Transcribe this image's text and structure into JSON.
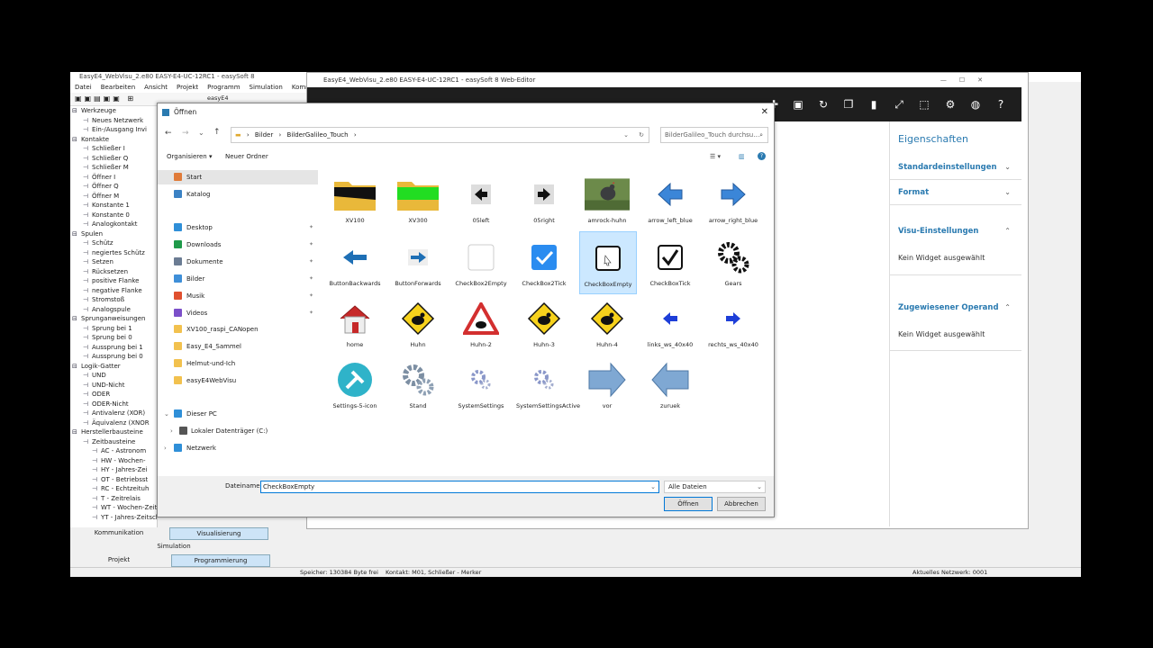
{
  "back_window": {
    "title": "EasyE4_WebVisu_2.e80 EASY-E4-UC-12RC1 - easySoft 8",
    "menu": [
      "Datei",
      "Bearbeiten",
      "Ansicht",
      "Projekt",
      "Programm",
      "Simulation",
      "Kommunikation"
    ],
    "toolbar_combo": "easyE4"
  },
  "tree": [
    {
      "label": "Werkzeuge",
      "level": 0
    },
    {
      "label": "Neues Netzwerk",
      "level": 1
    },
    {
      "label": "Ein-/Ausgang Invi",
      "level": 1
    },
    {
      "label": "Kontakte",
      "level": 0
    },
    {
      "label": "Schließer I",
      "level": 1
    },
    {
      "label": "Schließer Q",
      "level": 1
    },
    {
      "label": "Schließer M",
      "level": 1
    },
    {
      "label": "Öffner I",
      "level": 1
    },
    {
      "label": "Öffner Q",
      "level": 1
    },
    {
      "label": "Öffner M",
      "level": 1
    },
    {
      "label": "Konstante 1",
      "level": 1
    },
    {
      "label": "Konstante 0",
      "level": 1
    },
    {
      "label": "Analogkontakt",
      "level": 1
    },
    {
      "label": "Spulen",
      "level": 0
    },
    {
      "label": "Schütz",
      "level": 1
    },
    {
      "label": "negiertes Schütz",
      "level": 1
    },
    {
      "label": "Setzen",
      "level": 1
    },
    {
      "label": "Rücksetzen",
      "level": 1
    },
    {
      "label": "positive Flanke",
      "level": 1
    },
    {
      "label": "negative Flanke",
      "level": 1
    },
    {
      "label": "Stromstoß",
      "level": 1
    },
    {
      "label": "Analogspule",
      "level": 1
    },
    {
      "label": "Sprunganweisungen",
      "level": 0
    },
    {
      "label": "Sprung bei 1",
      "level": 1
    },
    {
      "label": "Sprung bei 0",
      "level": 1
    },
    {
      "label": "Aussprung bei 1",
      "level": 1
    },
    {
      "label": "Aussprung bei 0",
      "level": 1
    },
    {
      "label": "Logik-Gatter",
      "level": 0
    },
    {
      "label": "UND",
      "level": 1
    },
    {
      "label": "UND-Nicht",
      "level": 1
    },
    {
      "label": "ODER",
      "level": 1
    },
    {
      "label": "ODER-Nicht",
      "level": 1
    },
    {
      "label": "Antivalenz (XOR)",
      "level": 1
    },
    {
      "label": "Äquivalenz (XNOR",
      "level": 1
    },
    {
      "label": "Herstellerbausteine",
      "level": 0
    },
    {
      "label": "Zeitbausteine",
      "level": 1
    },
    {
      "label": "AC - Astronom",
      "level": 2
    },
    {
      "label": "HW - Wochen-",
      "level": 2
    },
    {
      "label": "HY - Jahres-Zei",
      "level": 2
    },
    {
      "label": "OT - Betriebsst",
      "level": 2
    },
    {
      "label": "RC - Echtzeituh",
      "level": 2
    },
    {
      "label": "T - Zeitrelais",
      "level": 2
    },
    {
      "label": "WT - Wochen-Zeitschaltuhr (neu)",
      "level": 2
    },
    {
      "label": "YT - Jahres-Zeitschaltuhr (neu)",
      "level": 2
    }
  ],
  "bottom_left": {
    "kommunikation": "Kommunikation",
    "visualisierung": "Visualisierung",
    "simulation": "Simulation",
    "projekt": "Projekt",
    "programmierung": "Programmierung"
  },
  "statusbar": {
    "memory": "Speicher: 130384 Byte frei",
    "contact": "Kontakt: M01, Schließer - Merker",
    "network": "Aktuelles Netzwerk: 0001"
  },
  "editor": {
    "title": "EasyE4_WebVisu_2.e80 EASY-E4-UC-12RC1 - easySoft 8 Web-Editor",
    "props": {
      "heading": "Eigenschaften",
      "standard": "Standardeinstellungen",
      "format": "Format",
      "visu": "Visu-Einstellungen",
      "visu_text": "Kein Widget ausgewählt",
      "operand": "Zugewiesener Operand",
      "operand_text": "Kein Widget ausgewählt"
    }
  },
  "dialog": {
    "title": "Öffnen",
    "breadcrumb": [
      "Bilder",
      "BilderGalileo_Touch"
    ],
    "search_placeholder": "BilderGalileo_Touch durchsu...",
    "organize": "Organisieren ▾",
    "new_folder": "Neuer Ordner",
    "nav": [
      {
        "label": "Start",
        "icon": "home-icon",
        "color": "#e07b39",
        "selected": true
      },
      {
        "label": "Katalog",
        "icon": "gallery-icon",
        "color": "#3b82c4"
      },
      {
        "label": "Desktop",
        "icon": "desktop-icon",
        "color": "#2f8fd8",
        "pinned": true
      },
      {
        "label": "Downloads",
        "icon": "downloads-icon",
        "color": "#1f9a4a",
        "pinned": true
      },
      {
        "label": "Dokumente",
        "icon": "documents-icon",
        "color": "#6b7c93",
        "pinned": true
      },
      {
        "label": "Bilder",
        "icon": "pictures-icon",
        "color": "#3f8fd8",
        "pinned": true
      },
      {
        "label": "Musik",
        "icon": "music-icon",
        "color": "#e0502f",
        "pinned": true
      },
      {
        "label": "Videos",
        "icon": "videos-icon",
        "color": "#7b4fc9",
        "pinned": true
      },
      {
        "label": "XV100_raspi_CANopen",
        "icon": "folder-icon",
        "color": "#f2c14e"
      },
      {
        "label": "Easy_E4_Sammel",
        "icon": "folder-icon",
        "color": "#f2c14e"
      },
      {
        "label": "Helmut-und-Ich",
        "icon": "folder-icon",
        "color": "#f2c14e"
      },
      {
        "label": "easyE4WebVisu",
        "icon": "folder-icon",
        "color": "#f2c14e"
      },
      {
        "label": "Dieser PC",
        "icon": "pc-icon",
        "color": "#2f8fd8",
        "expanded": true
      },
      {
        "label": "Lokaler Datenträger (C:)",
        "icon": "drive-icon",
        "color": "#555"
      },
      {
        "label": "Netzwerk",
        "icon": "network-icon",
        "color": "#2f8fd8"
      }
    ],
    "files": [
      {
        "name": "XV100",
        "kind": "folder-black"
      },
      {
        "name": "XV300",
        "kind": "folder-green"
      },
      {
        "name": "05left",
        "kind": "arrow-left-black"
      },
      {
        "name": "05right",
        "kind": "arrow-right-black"
      },
      {
        "name": "amrock-huhn",
        "kind": "photo"
      },
      {
        "name": "arrow_left_blue",
        "kind": "arrow-left-blue"
      },
      {
        "name": "arrow_right_blue",
        "kind": "arrow-right-blue"
      },
      {
        "name": "ButtonBackwards",
        "kind": "btn-back"
      },
      {
        "name": "ButtonForwards",
        "kind": "btn-fwd"
      },
      {
        "name": "CheckBox2Empty",
        "kind": "cb-empty-grey"
      },
      {
        "name": "CheckBox2Tick",
        "kind": "cb-blue-tick"
      },
      {
        "name": "CheckBoxEmpty",
        "kind": "cb-empty",
        "selected": true
      },
      {
        "name": "CheckBoxTick",
        "kind": "cb-tick"
      },
      {
        "name": "Gears",
        "kind": "gears"
      },
      {
        "name": "home",
        "kind": "home"
      },
      {
        "name": "Huhn",
        "kind": "sign-yellow"
      },
      {
        "name": "Huhn-2",
        "kind": "sign-red"
      },
      {
        "name": "Huhn-3",
        "kind": "sign-yellow"
      },
      {
        "name": "Huhn-4",
        "kind": "sign-yellow"
      },
      {
        "name": "links_ws_40x40",
        "kind": "small-left"
      },
      {
        "name": "rechts_ws_40x40",
        "kind": "small-right"
      },
      {
        "name": "Settings-5-icon",
        "kind": "settings-round"
      },
      {
        "name": "Stand",
        "kind": "gears-grey"
      },
      {
        "name": "SystemSettings",
        "kind": "gears-small"
      },
      {
        "name": "SystemSettingsActive",
        "kind": "gears-small"
      },
      {
        "name": "vor",
        "kind": "big-arrow-right"
      },
      {
        "name": "zuruek",
        "kind": "big-arrow-left"
      }
    ],
    "filename_label": "Dateiname:",
    "filename_value": "CheckBoxEmpty",
    "filter": "Alle Dateien",
    "open": "Öffnen",
    "cancel": "Abbrechen"
  }
}
